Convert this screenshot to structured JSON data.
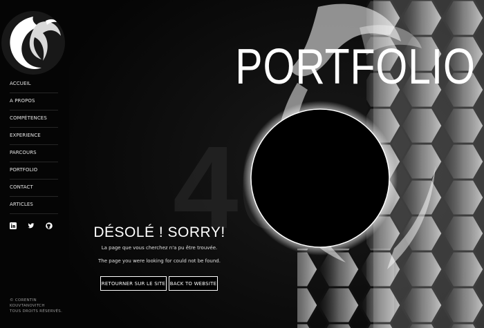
{
  "sidebar": {
    "nav": [
      "Accueil",
      "A propos",
      "Compétences",
      "Experience",
      "Parcours",
      "Portfolio",
      "Contact",
      "Articles"
    ],
    "social_icons": [
      "linkedin-icon",
      "twitter-icon",
      "github-icon"
    ],
    "copyright": [
      "© Corentin",
      "Kouvtanovitch",
      "Tous droits réservés."
    ]
  },
  "hero": {
    "title": "PORTFOLIO",
    "error_code": "404"
  },
  "error": {
    "heading": "DÉSOLÉ ! SORRY!",
    "message_fr": "La page que vous cherchez n'a pu être trouvée.",
    "message_en": "The page you were looking for could not be found.",
    "button_return": "Retourner sur le site",
    "button_back": "Back to website"
  }
}
